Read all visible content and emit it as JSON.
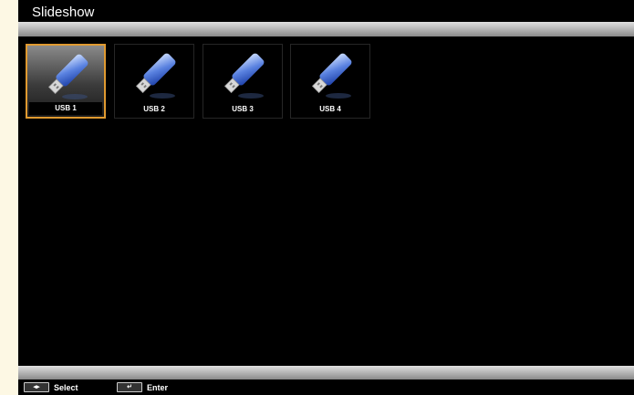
{
  "title": "Slideshow",
  "devices": [
    {
      "label": "USB 1",
      "selected": true
    },
    {
      "label": "USB 2",
      "selected": false
    },
    {
      "label": "USB 3",
      "selected": false
    },
    {
      "label": "USB 4",
      "selected": false
    }
  ],
  "footer": {
    "select_label": "Select",
    "enter_label": "Enter",
    "select_icon": "left-right-arrows-icon",
    "enter_icon": "enter-key-icon"
  },
  "colors": {
    "background": "#000000",
    "accent_border": "#e09a30",
    "margin": "#fdf8e4"
  }
}
